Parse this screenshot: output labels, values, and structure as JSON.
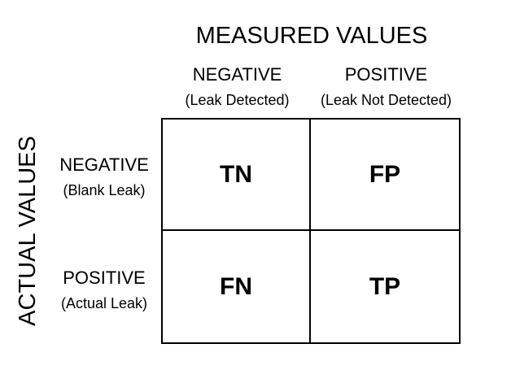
{
  "header": {
    "title": "MEASURED VALUES",
    "columns": [
      {
        "label": "NEGATIVE",
        "sub": "(Leak Detected)"
      },
      {
        "label": "POSITIVE",
        "sub": "(Leak Not Detected)"
      }
    ]
  },
  "side": {
    "title": "ACTUAL VALUES",
    "rows": [
      {
        "label": "NEGATIVE",
        "sub": "(Blank Leak)"
      },
      {
        "label": "POSITIVE",
        "sub": "(Actual Leak)"
      }
    ]
  },
  "matrix": {
    "cells": [
      [
        "TN",
        "FP"
      ],
      [
        "FN",
        "TP"
      ]
    ]
  }
}
